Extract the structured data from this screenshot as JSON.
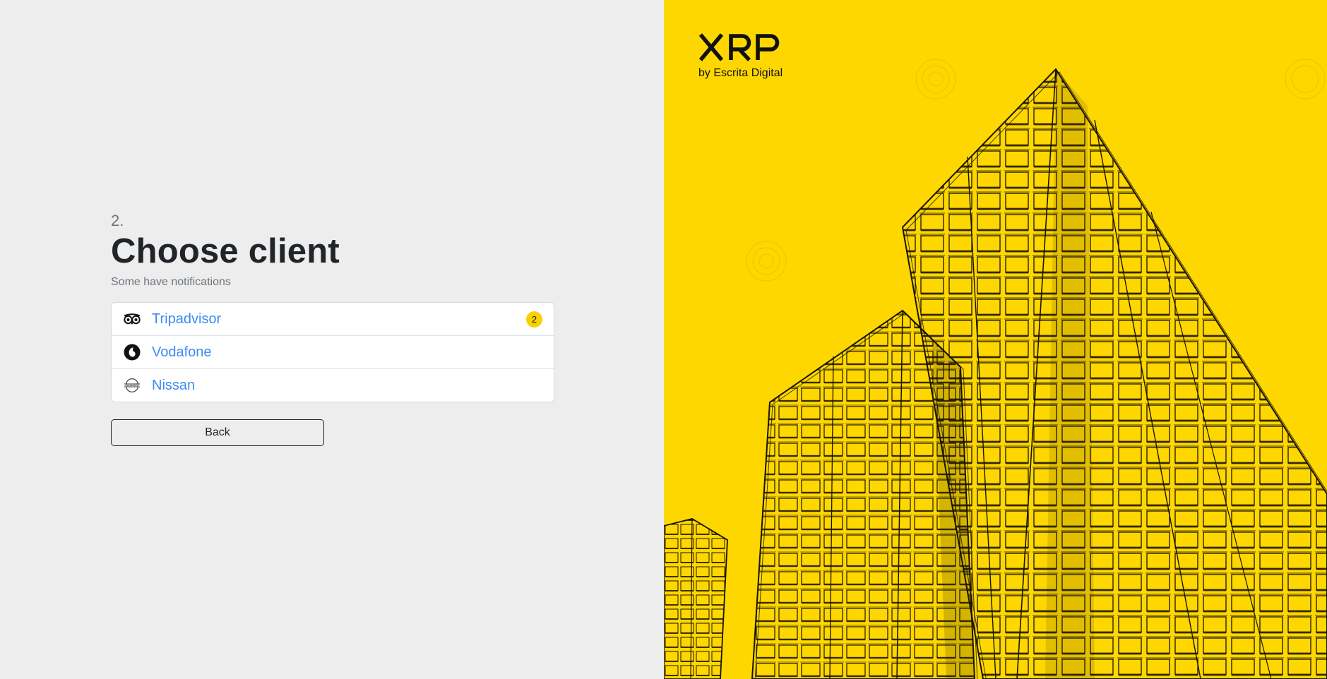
{
  "step": {
    "number": "2.",
    "title": "Choose client",
    "subtitle": "Some have notifications"
  },
  "clients": [
    {
      "name": "Tripadvisor",
      "icon": "tripadvisor-owl-icon",
      "notifications": "2"
    },
    {
      "name": "Vodafone",
      "icon": "vodafone-speechmark-icon",
      "notifications": null
    },
    {
      "name": "Nissan",
      "icon": "nissan-emblem-icon",
      "notifications": null
    }
  ],
  "actions": {
    "back_label": "Back"
  },
  "brand": {
    "logo_text": "XRP",
    "tagline": "by Escrita Digital"
  },
  "colors": {
    "accent_yellow": "#fed700",
    "badge_yellow": "#f8d004",
    "link_blue": "#3d8bf2",
    "left_background": "#ededed"
  }
}
